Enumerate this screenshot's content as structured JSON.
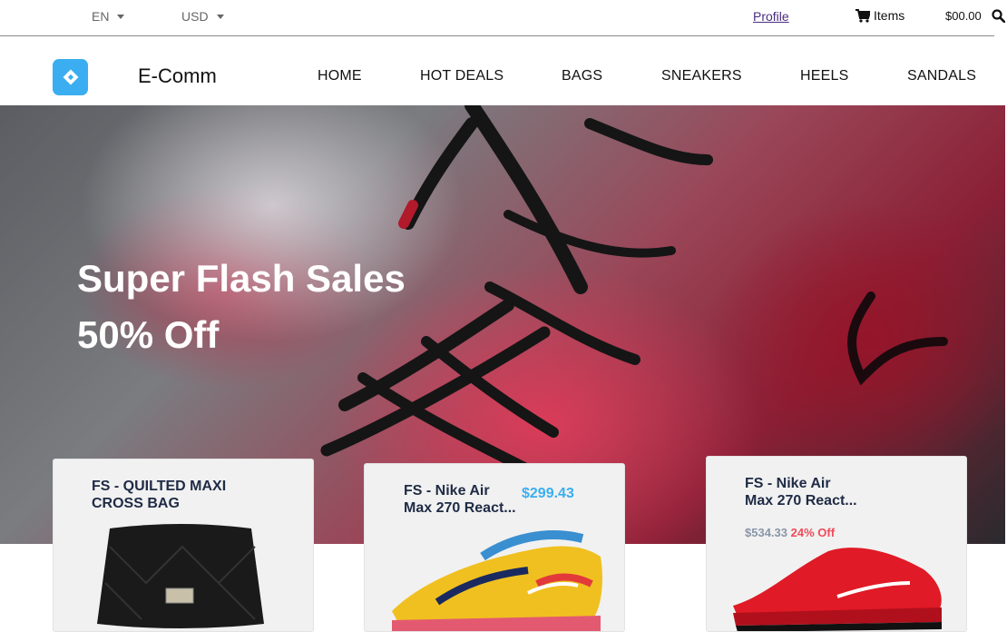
{
  "topbar": {
    "language": "EN",
    "currency": "USD",
    "profile_label": "Profile",
    "cart_label": "Items",
    "cart_total": "$00.00"
  },
  "navbar": {
    "brand": "E-Comm",
    "items": [
      "HOME",
      "HOT DEALS",
      "BAGS",
      "SNEAKERS",
      "HEELS",
      "SANDALS"
    ]
  },
  "hero": {
    "title": "Super Flash Sales",
    "subtitle": "50% Off"
  },
  "products": [
    {
      "name_line1": "FS - QUILTED MAXI",
      "name_line2": "CROSS BAG",
      "image": "black-quilted-bag"
    },
    {
      "name_line1": "FS - Nike Air",
      "name_line2": "Max 270 React...",
      "price": "$299.43",
      "image": "multicolor-sneaker"
    },
    {
      "name_line1": "FS - Nike Air",
      "name_line2": "Max 270 React...",
      "old_price": "$534.33",
      "discount": "24% Off",
      "image": "red-sneaker"
    }
  ],
  "icons": [
    "caret-down-icon",
    "cart-icon",
    "search-icon",
    "logo-icon"
  ],
  "colors": {
    "accent": "#3aaef0",
    "discount": "#ef4b5a",
    "title": "#1f2b45"
  }
}
